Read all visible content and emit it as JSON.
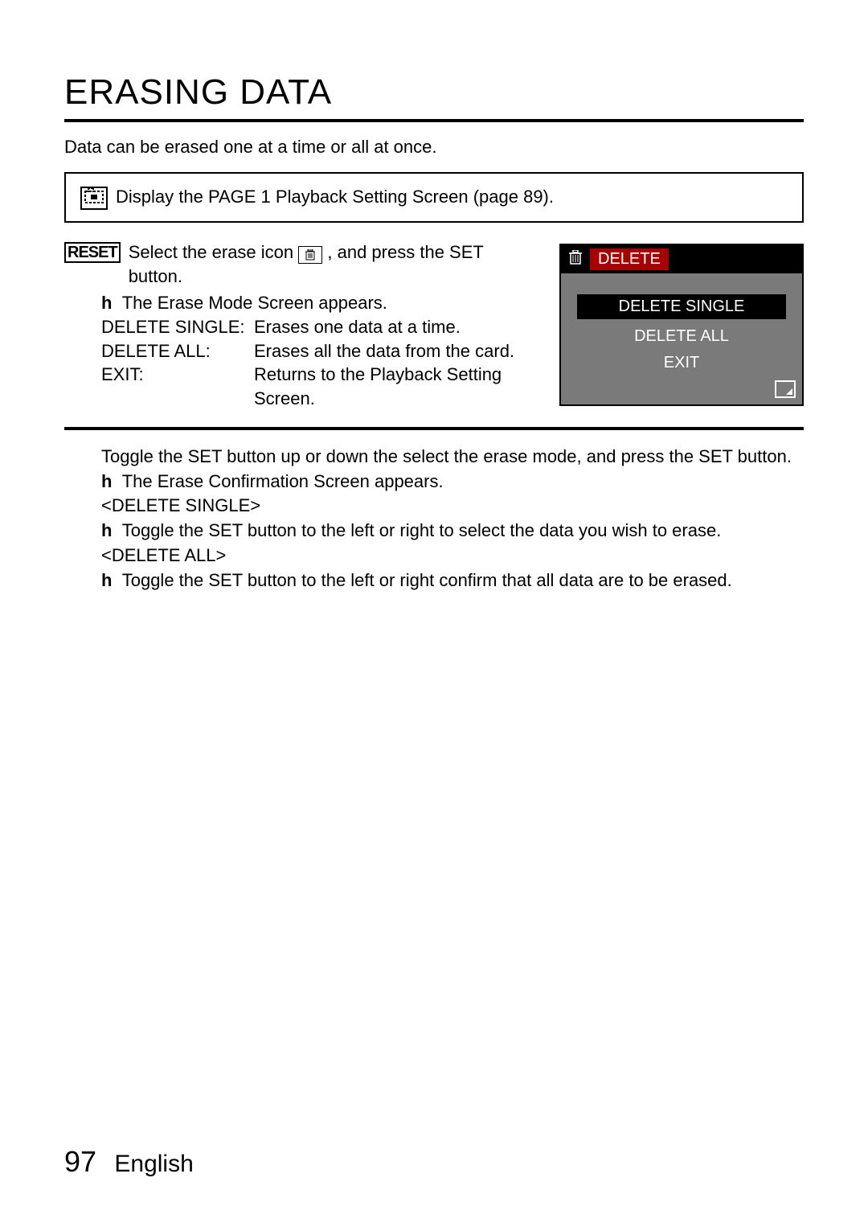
{
  "title": "ERASING DATA",
  "intro": "Data can be erased one at a time or all at once.",
  "step1": {
    "text": "Display the PAGE 1 Playback Setting Screen (page 89)."
  },
  "step2": {
    "line1_a": "Select the erase icon ",
    "line1_b": ", and press the SET button.",
    "bullet1": "The Erase Mode Screen appears.",
    "defs": [
      {
        "term": "DELETE SINGLE:",
        "desc": "Erases one data at a time."
      },
      {
        "term": "DELETE ALL:",
        "desc": "Erases all the data from the card."
      },
      {
        "term": "EXIT:",
        "desc": "Returns to the Playback Setting Screen."
      }
    ]
  },
  "screen": {
    "header": "DELETE",
    "opt1": "DELETE SINGLE",
    "opt2": "DELETE ALL",
    "opt3": "EXIT"
  },
  "step3": {
    "line1": "Toggle the SET button up or down the select the erase mode, and press the SET button.",
    "bullet1": "The Erase Confirmation Screen appears.",
    "head1": "<DELETE SINGLE>",
    "bullet2": "Toggle the SET button to the left or right to select the data you wish to erase.",
    "head2": "<DELETE ALL>",
    "bullet3": "Toggle the SET button to the left or right confirm that all data are to be erased."
  },
  "footer": {
    "page": "97",
    "lang": "English"
  },
  "icons": {
    "step1_marker": "▣",
    "reset_marker": "RESET",
    "trash": "🗑"
  }
}
